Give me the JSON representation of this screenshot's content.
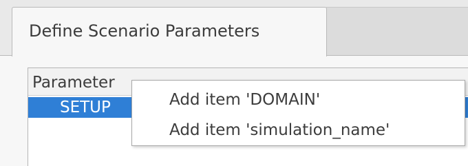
{
  "tabs": [
    {
      "label": "Define Scenario Parameters"
    }
  ],
  "tree": {
    "header": "Parameter",
    "rows": [
      {
        "label": "SETUP",
        "selected": true
      }
    ]
  },
  "context_menu": {
    "items": [
      {
        "label": "Add item 'DOMAIN'"
      },
      {
        "label": "Add item 'simulation_name'"
      }
    ]
  },
  "colors": {
    "selection": "#2f7fd6",
    "tab_active": "#f7f7f7",
    "tab_inactive": "#dcdcdc"
  }
}
